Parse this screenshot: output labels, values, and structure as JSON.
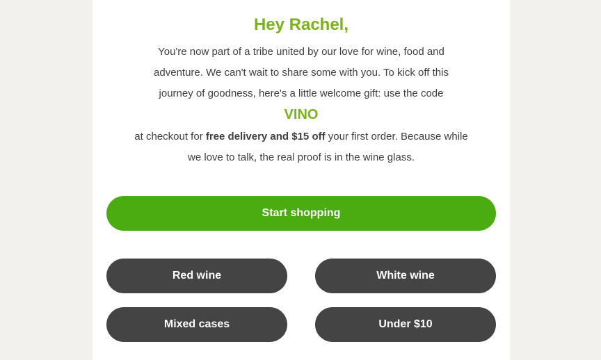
{
  "email": {
    "greeting": "Hey Rachel,",
    "intro": "You're now part of a tribe united by our love for wine, food and adventure. We can't wait to share some with you. To kick off this journey of goodness, here's a little welcome gift: use the code",
    "promo_code": "VINO",
    "offer_prefix": "at checkout for ",
    "offer_bold": "free delivery and $15 off",
    "offer_suffix": " your first order. Because while we love to talk, the real proof is in the wine glass.",
    "cta_label": "Start shopping",
    "categories": [
      {
        "label": "Red wine"
      },
      {
        "label": "White wine"
      },
      {
        "label": "Mixed cases"
      },
      {
        "label": "Under $10"
      }
    ]
  },
  "colors": {
    "background": "#f2f1ed",
    "card": "#ffffff",
    "accent_green": "#7ab317",
    "cta_green": "#4aac10",
    "dark_button": "#444444",
    "text": "#3f3f3f"
  }
}
